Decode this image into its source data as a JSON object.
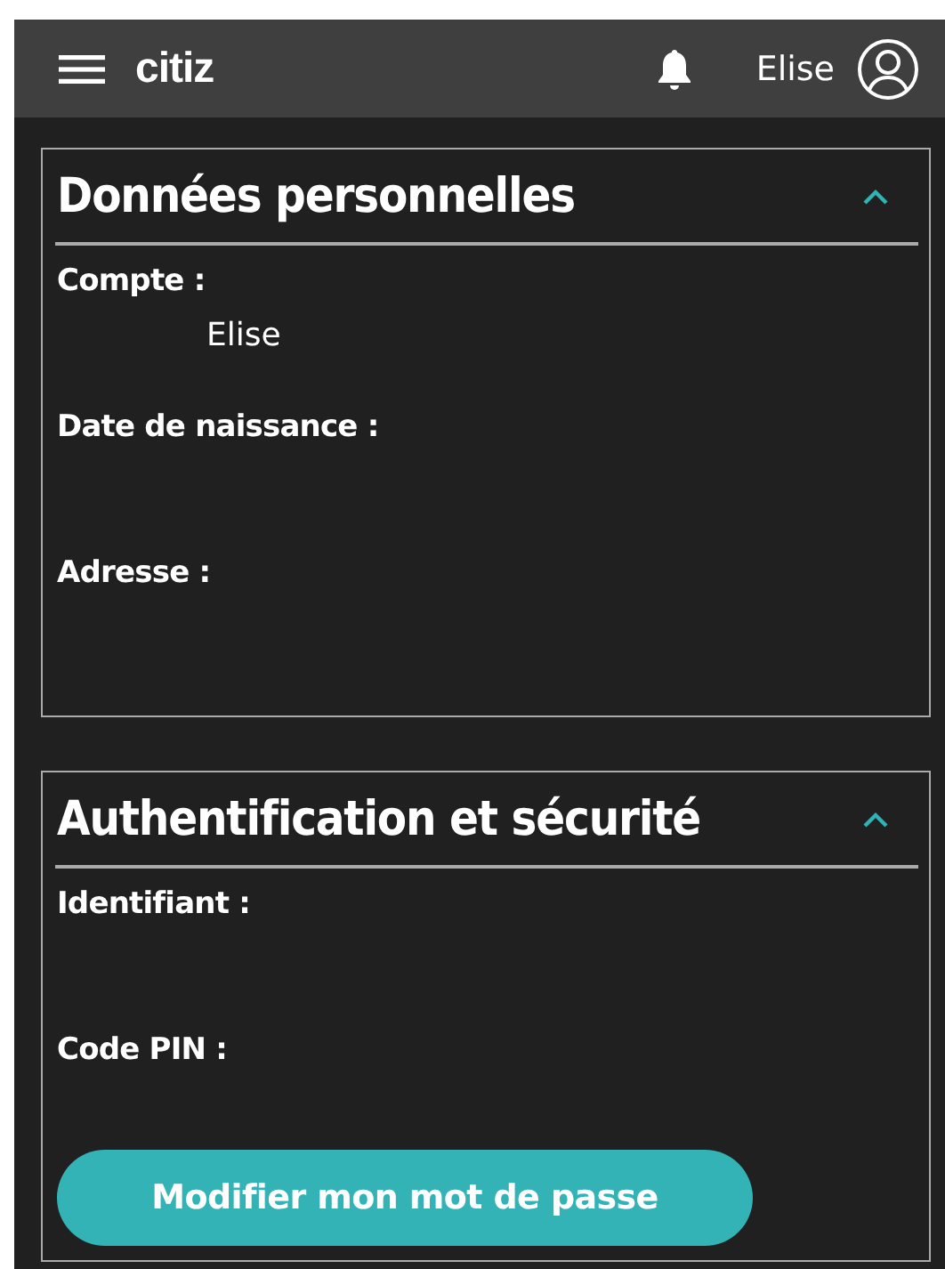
{
  "header": {
    "brand": "citiz",
    "user_name": "Elise"
  },
  "sections": [
    {
      "title": "Données personnelles",
      "expanded": true,
      "fields": [
        {
          "label": "Compte :",
          "value": "Elise"
        },
        {
          "label": "Date de naissance :"
        },
        {
          "label": "Adresse :"
        }
      ]
    },
    {
      "title": "Authentification et sécurité",
      "expanded": true,
      "fields": [
        {
          "label": "Identifiant :"
        },
        {
          "label": "Code PIN :"
        }
      ],
      "button": "Modifier mon mot de passe"
    }
  ]
}
